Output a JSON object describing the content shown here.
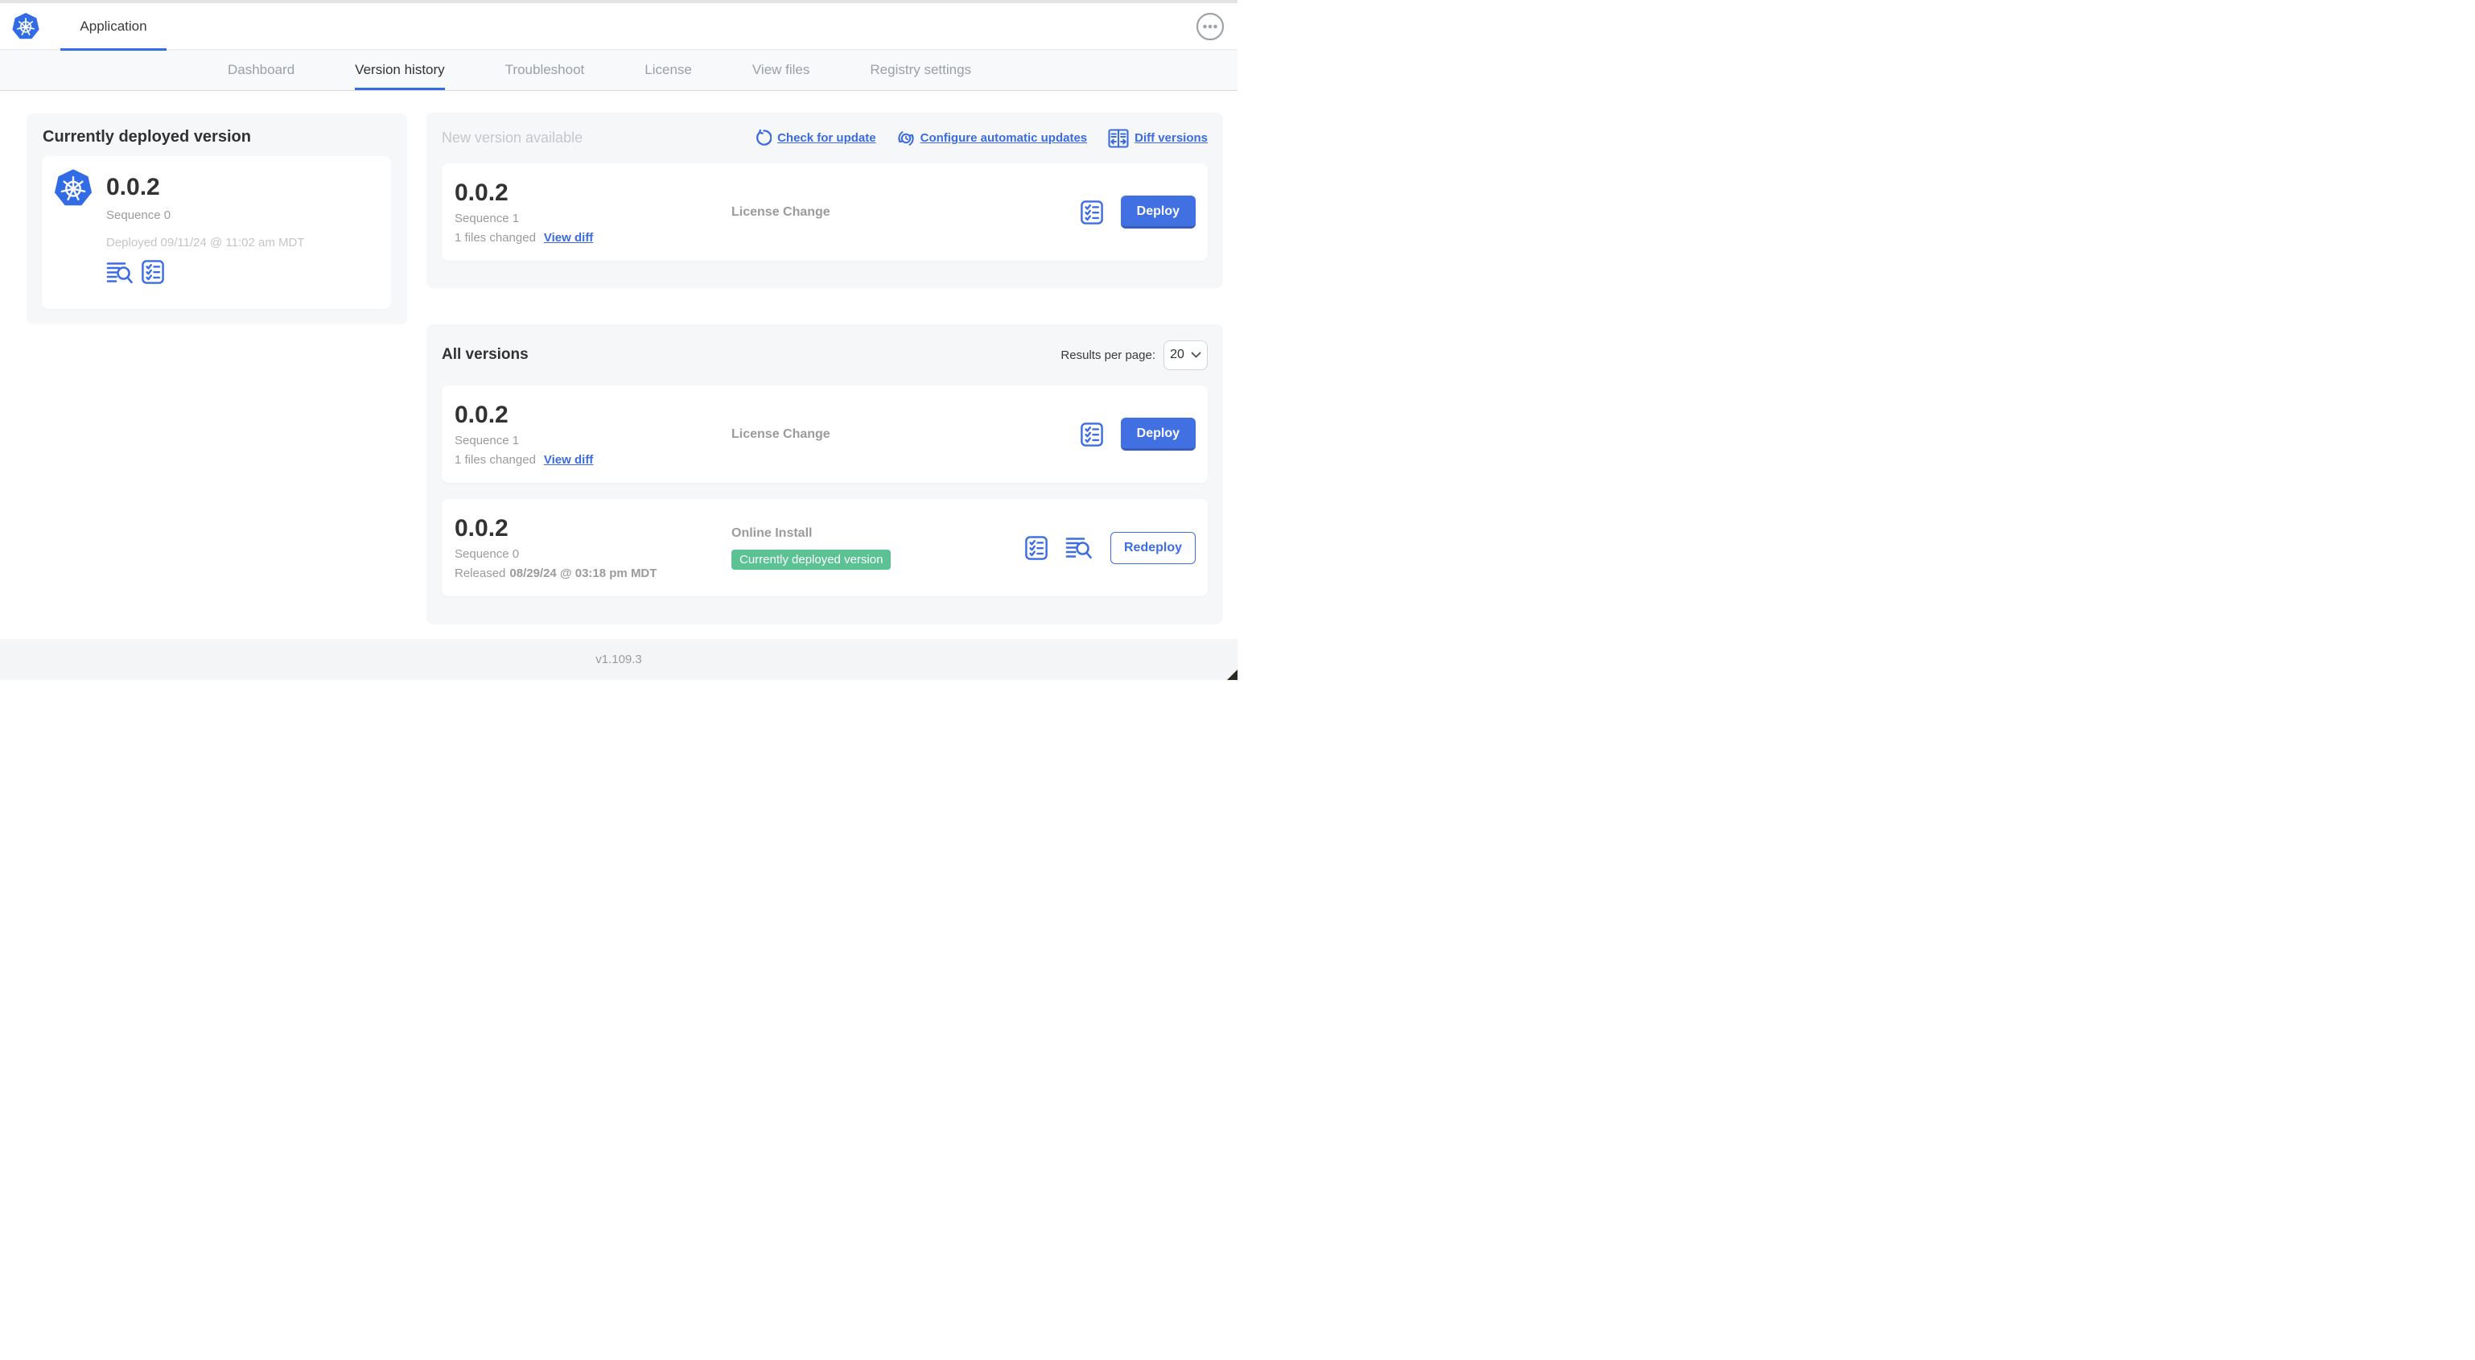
{
  "header": {
    "app_tab": "Application"
  },
  "nav": {
    "tabs": [
      {
        "label": "Dashboard",
        "active": false
      },
      {
        "label": "Version history",
        "active": true
      },
      {
        "label": "Troubleshoot",
        "active": false
      },
      {
        "label": "License",
        "active": false
      },
      {
        "label": "View files",
        "active": false
      },
      {
        "label": "Registry settings",
        "active": false
      }
    ]
  },
  "current_version": {
    "heading": "Currently deployed version",
    "version": "0.0.2",
    "sequence": "Sequence 0",
    "deployed": "Deployed 09/11/24 @ 11:02 am MDT",
    "icons": [
      "logs-icon",
      "checklist-icon"
    ]
  },
  "new_version": {
    "heading": "New version available",
    "actions": [
      {
        "label": "Check for update",
        "icon": "refresh-icon"
      },
      {
        "label": "Configure automatic updates",
        "icon": "schedule-icon"
      },
      {
        "label": "Diff versions",
        "icon": "diff-icon"
      }
    ],
    "row": {
      "version": "0.0.2",
      "sequence": "Sequence 1",
      "files_changed": "1 files changed",
      "view_diff": "View diff",
      "source": "License Change",
      "action": "Deploy"
    }
  },
  "all_versions": {
    "heading": "All versions",
    "results_label": "Results per page:",
    "results_value": "20",
    "rows": [
      {
        "version": "0.0.2",
        "sequence": "Sequence 1",
        "files_changed": "1 files changed",
        "view_diff": "View diff",
        "source": "License Change",
        "action": "Deploy"
      },
      {
        "version": "0.0.2",
        "sequence": "Sequence 0",
        "released_prefix": "Released",
        "released_date": "08/29/24 @ 03:18 pm MDT",
        "source": "Online Install",
        "badge": "Currently deployed version",
        "action": "Redeploy"
      }
    ]
  },
  "footer": {
    "version": "v1.109.3"
  },
  "colors": {
    "accent_blue": "#3d6de4",
    "logo_blue": "#326ce5",
    "link_blue": "#3b6bdd",
    "button_blue": "#4170e2",
    "badge_green": "#5bc294",
    "tab_underline": "#326de6",
    "panel_gray": "#f6f7f9",
    "text_dark": "#323232",
    "text_gray": "#9b9b9b",
    "text_light_gray": "#c4c7cb"
  }
}
